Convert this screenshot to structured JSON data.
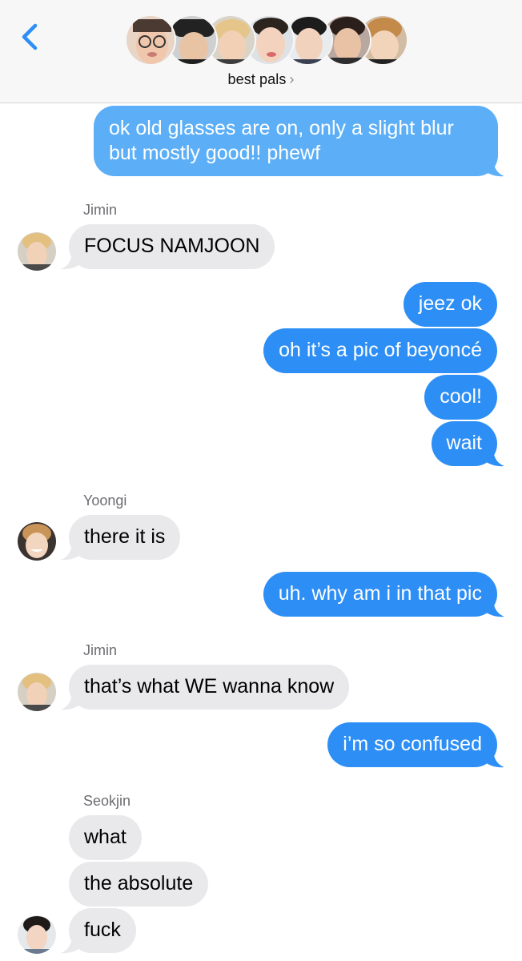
{
  "header": {
    "group_name": "best pals",
    "chevron": "›",
    "back_icon": "chevron-left-icon",
    "accent_color": "#2d8ef5",
    "member_avatars": [
      "avatar-1",
      "avatar-2",
      "avatar-3",
      "avatar-4",
      "avatar-5",
      "avatar-6",
      "avatar-7"
    ]
  },
  "messages": [
    {
      "from": "me",
      "lines": [
        "ok old glasses are on, only a slight blur",
        "but mostly good!! phewf"
      ]
    },
    {
      "from": "Jimin",
      "sender_label": "Jimin",
      "text": "FOCUS NAMJOON"
    },
    {
      "from": "me",
      "text": "jeez ok"
    },
    {
      "from": "me",
      "text": "oh it’s a pic of beyoncé"
    },
    {
      "from": "me",
      "text": "cool!"
    },
    {
      "from": "me",
      "text": "wait"
    },
    {
      "from": "Yoongi",
      "sender_label": "Yoongi",
      "text": "there it is"
    },
    {
      "from": "me",
      "text": "uh. why am i in that pic"
    },
    {
      "from": "Jimin",
      "sender_label": "Jimin",
      "text": "that’s what WE wanna know"
    },
    {
      "from": "me",
      "text": "i’m so confused"
    },
    {
      "from": "Seokjin",
      "sender_label": "Seokjin",
      "text": "what"
    },
    {
      "from": "Seokjin",
      "text": "the absolute"
    },
    {
      "from": "Seokjin",
      "text": "fuck"
    }
  ],
  "colors": {
    "sent_bubble": "#2d8ef5",
    "sent_bubble_light": "#5caff7",
    "received_bubble": "#e9e9eb",
    "sender_label": "#6d6d72"
  }
}
